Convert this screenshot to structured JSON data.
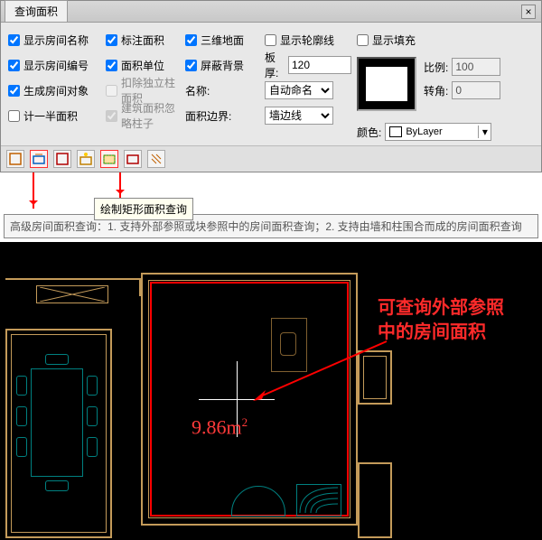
{
  "titlebar": {
    "tab": "查询面积"
  },
  "checks": {
    "showRoomName": "显示房间名称",
    "showRoomNumber": "显示房间编号",
    "genRoomObj": "生成房间对象",
    "halfArea": "计一半面积",
    "dimArea": "标注面积",
    "areaUnit": "面积单位",
    "deductCol": "扣除独立柱面积",
    "ignoreCol": "建筑面积忽略柱子",
    "floor3d": "三维地面",
    "maskBg": "屏蔽背景",
    "showOutline": "显示轮廓线",
    "showFill": "显示填充"
  },
  "labels": {
    "slabThick": "板厚:",
    "name": "名称:",
    "areaBoundary": "面积边界:",
    "ratio": "比例:",
    "rotation": "转角:",
    "color": "颜色:"
  },
  "values": {
    "slabThick": "120",
    "name": "自动命名",
    "areaBoundary": "墙边线",
    "ratio": "100",
    "rotation": "0",
    "colorName": "ByLayer"
  },
  "tooltip": "绘制矩形面积查询",
  "helpText": "高级房间面积查询：1. 支持外部参照或块参照中的房间面积查询；2. 支持由墙和柱围合而成的房间面积查询",
  "cad": {
    "areaValue": "9.86m",
    "areaExp": "2",
    "annotation": "可查询外部参照\n中的房间面积"
  }
}
